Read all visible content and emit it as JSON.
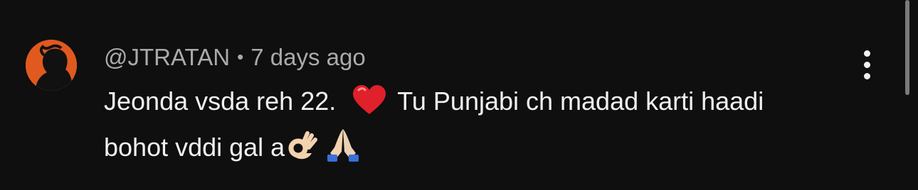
{
  "comment": {
    "author": "@JTRATAN",
    "separator": "•",
    "time": "7 days ago",
    "text_part1": "Jeonda vsda reh 22.",
    "text_part2": "Tu Punjabi ch madad karti haadi bohot vddi gal a",
    "emojis": [
      "heart-emoji",
      "ok-hand-emoji",
      "folded-hands-emoji"
    ]
  },
  "icons": {
    "avatar": "avatar-silhouette",
    "menu": "more-vert-icon"
  },
  "colors": {
    "background": "#0f0f0f",
    "primary_text": "#f1f1f1",
    "secondary_text": "#aaaaaa",
    "avatar_bg": "#e0591f",
    "heart": "#e0202a"
  }
}
